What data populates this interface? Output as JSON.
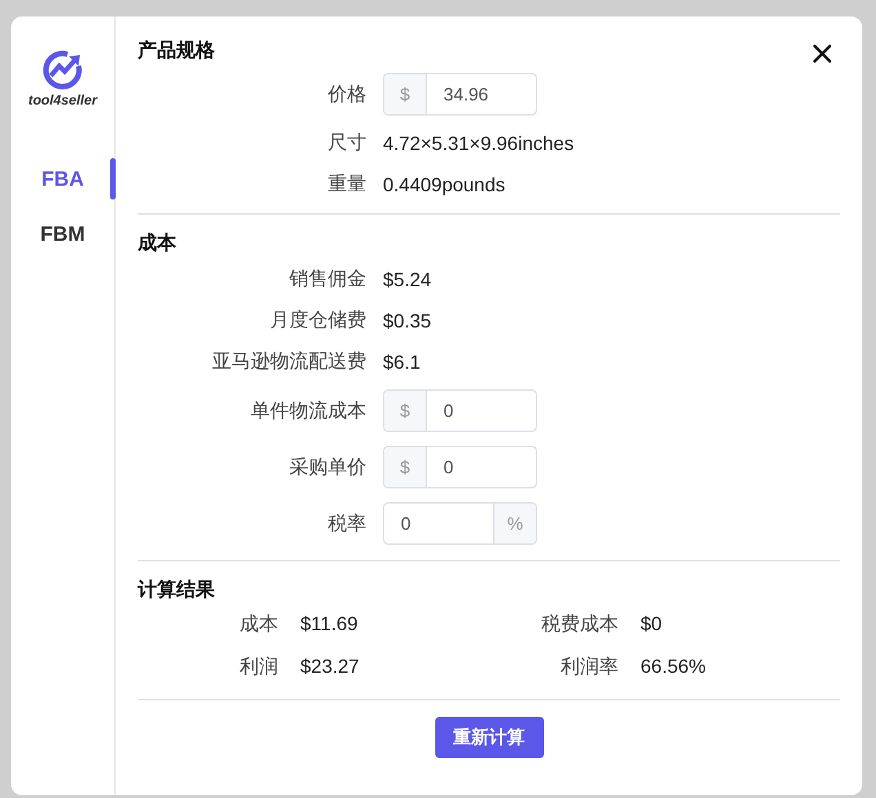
{
  "sidebar": {
    "logo_text": "tool4seller",
    "tabs": [
      {
        "label": "FBA",
        "selected": true
      },
      {
        "label": "FBM",
        "selected": false
      }
    ]
  },
  "sections": [
    {
      "title": "产品规格",
      "rows": [
        {
          "kind": "input",
          "label": "价格",
          "prefix": "$",
          "value": "34.96"
        },
        {
          "kind": "text",
          "label": "尺寸",
          "value": "4.72×5.31×9.96inches"
        },
        {
          "kind": "text",
          "label": "重量",
          "value": "0.4409pounds"
        }
      ]
    },
    {
      "title": "成本",
      "rows": [
        {
          "kind": "text",
          "label": "销售佣金",
          "value": "$5.24"
        },
        {
          "kind": "text",
          "label": "月度仓储费",
          "value": "$0.35"
        },
        {
          "kind": "text",
          "label": "亚马逊物流配送费",
          "value": "$6.1"
        },
        {
          "kind": "input",
          "label": "单件物流成本",
          "prefix": "$",
          "value": "0"
        },
        {
          "kind": "input",
          "label": "采购单价",
          "prefix": "$",
          "value": "0"
        },
        {
          "kind": "input",
          "label": "税率",
          "suffix": "%",
          "value": "0"
        }
      ]
    }
  ],
  "results": {
    "title": "计算结果",
    "items": [
      {
        "label": "成本",
        "value": "$11.69"
      },
      {
        "label": "税费成本",
        "value": "$0"
      },
      {
        "label": "利润",
        "value": "$23.27"
      },
      {
        "label": "利润率",
        "value": "66.56%"
      }
    ]
  },
  "button": "重新计算"
}
